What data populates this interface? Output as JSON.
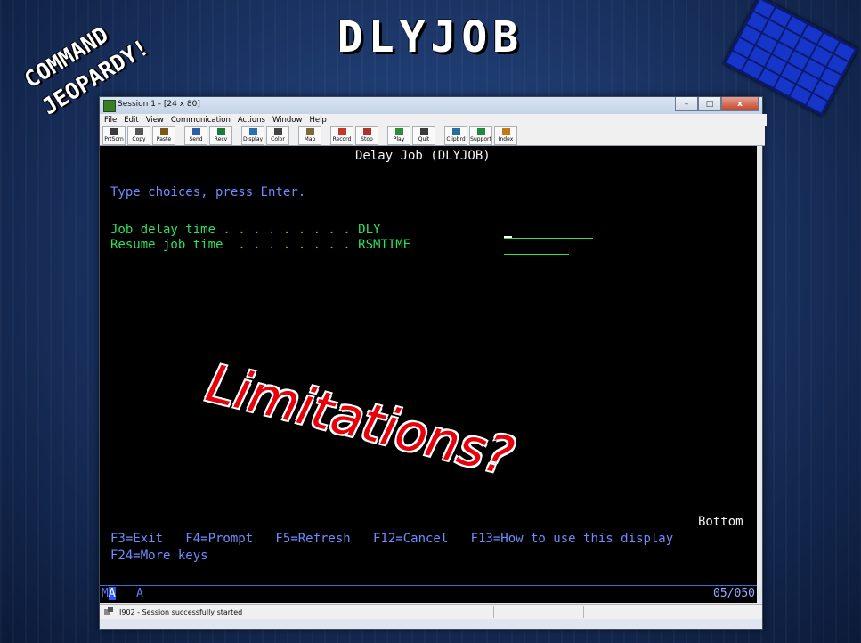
{
  "slide": {
    "title": "DLYJOB",
    "logo_line1": "COMMAND",
    "logo_line2": "JEOPARDY!",
    "overlay": "Limitations?"
  },
  "window": {
    "title": "Session 1 - [24 x 80]",
    "buttons": [
      "–",
      "□",
      "x"
    ]
  },
  "menu": [
    "File",
    "Edit",
    "View",
    "Communication",
    "Actions",
    "Window",
    "Help"
  ],
  "toolbar": [
    {
      "label": "PrtScrn",
      "icon": "print-screen-icon"
    },
    {
      "label": "Copy",
      "icon": "copy-icon"
    },
    {
      "label": "Paste",
      "icon": "paste-icon"
    },
    {
      "label": "Send",
      "icon": "send-icon"
    },
    {
      "label": "Recv",
      "icon": "receive-icon"
    },
    {
      "label": "Display",
      "icon": "display-icon"
    },
    {
      "label": "Color",
      "icon": "color-icon"
    },
    {
      "label": "Map",
      "icon": "map-icon"
    },
    {
      "label": "Record",
      "icon": "record-icon"
    },
    {
      "label": "Stop",
      "icon": "stop-icon"
    },
    {
      "label": "Play",
      "icon": "play-icon"
    },
    {
      "label": "Quit",
      "icon": "quit-icon"
    },
    {
      "label": "Clipbrd",
      "icon": "clipboard-icon"
    },
    {
      "label": "Support",
      "icon": "support-icon"
    },
    {
      "label": "Index",
      "icon": "index-icon"
    }
  ],
  "screen": {
    "heading": "Delay Job (DLYJOB)",
    "instruction": "Type choices, press Enter.",
    "field1_label": "Job delay time . . . . . . . . . DLY",
    "field2_label": "Resume job time  . . . . . . . . RSMTIME",
    "bottom": "Bottom",
    "fkeys_line1": "F3=Exit   F4=Prompt   F5=Refresh   F12=Cancel   F13=How to use this display",
    "fkeys_line2": "F24=More keys"
  },
  "oia": {
    "mode_prefix": "M",
    "mode_selected": "A",
    "indicator": "A",
    "cursor_pos": "05/050"
  },
  "statusbar": {
    "message": "I902 - Session successfully started"
  },
  "colors": {
    "terminal_bg": "#000000",
    "terminal_white": "#f2f2f2",
    "terminal_blue": "#6d8cff",
    "terminal_green": "#2fe05a",
    "overlay_red": "#e8000a"
  }
}
